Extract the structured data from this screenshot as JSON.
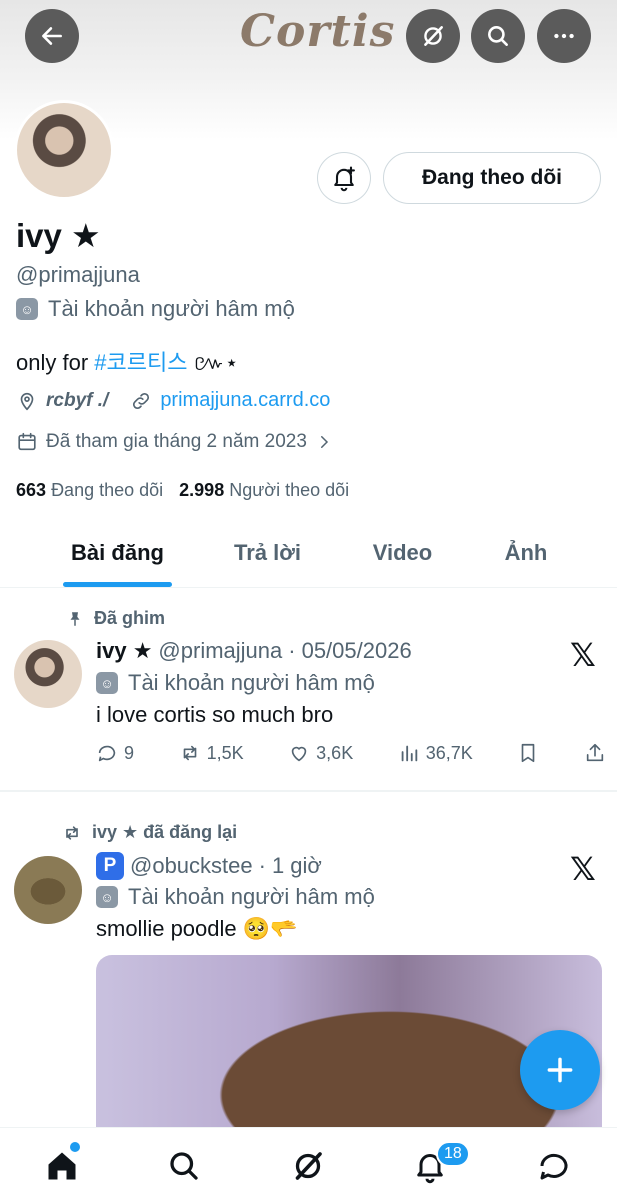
{
  "banner": {
    "logo_text": "Cortis"
  },
  "profile": {
    "display_name": "ivy ★",
    "handle": "@primajjuna",
    "fan_label": "Tài khoản người hâm mộ",
    "bio_prefix": "only for ",
    "bio_hashtag": "#코르티스",
    "bio_suffix": " ៚⋆",
    "location": "rcbyf ./",
    "website": "primajjuna.carrd.co",
    "joined": "Đã tham gia tháng 2 năm 2023",
    "following_count": "663",
    "following_label": "Đang theo dõi",
    "followers_count": "2.998",
    "followers_label": "Người theo dõi",
    "follow_button": "Đang theo dõi"
  },
  "tabs": [
    {
      "label": "Bài đăng",
      "active": true
    },
    {
      "label": "Trả lời",
      "active": false
    },
    {
      "label": "Video",
      "active": false
    },
    {
      "label": "Ảnh",
      "active": false
    }
  ],
  "posts": [
    {
      "context": "Đã ghim",
      "name": "ivy ★",
      "handle": "@primajjuna",
      "time": "05/05/2026",
      "fan_label": "Tài khoản người hâm mộ",
      "text": "i love cortis so much bro",
      "replies": "9",
      "reposts": "1,5K",
      "likes": "3,6K",
      "views": "36,7K"
    },
    {
      "context": "ivy ★ đã đăng lại",
      "badge": "P",
      "handle": "@obuckstee",
      "time": "1 giờ",
      "fan_label": "Tài khoản người hâm mộ",
      "text": "smollie poodle 🥺🫳"
    }
  ],
  "nav": {
    "notification_count": "18"
  },
  "x_logo": "𝕏",
  "colors": {
    "accent": "#1d9bf0",
    "muted": "#536471",
    "text": "#0f1419"
  }
}
